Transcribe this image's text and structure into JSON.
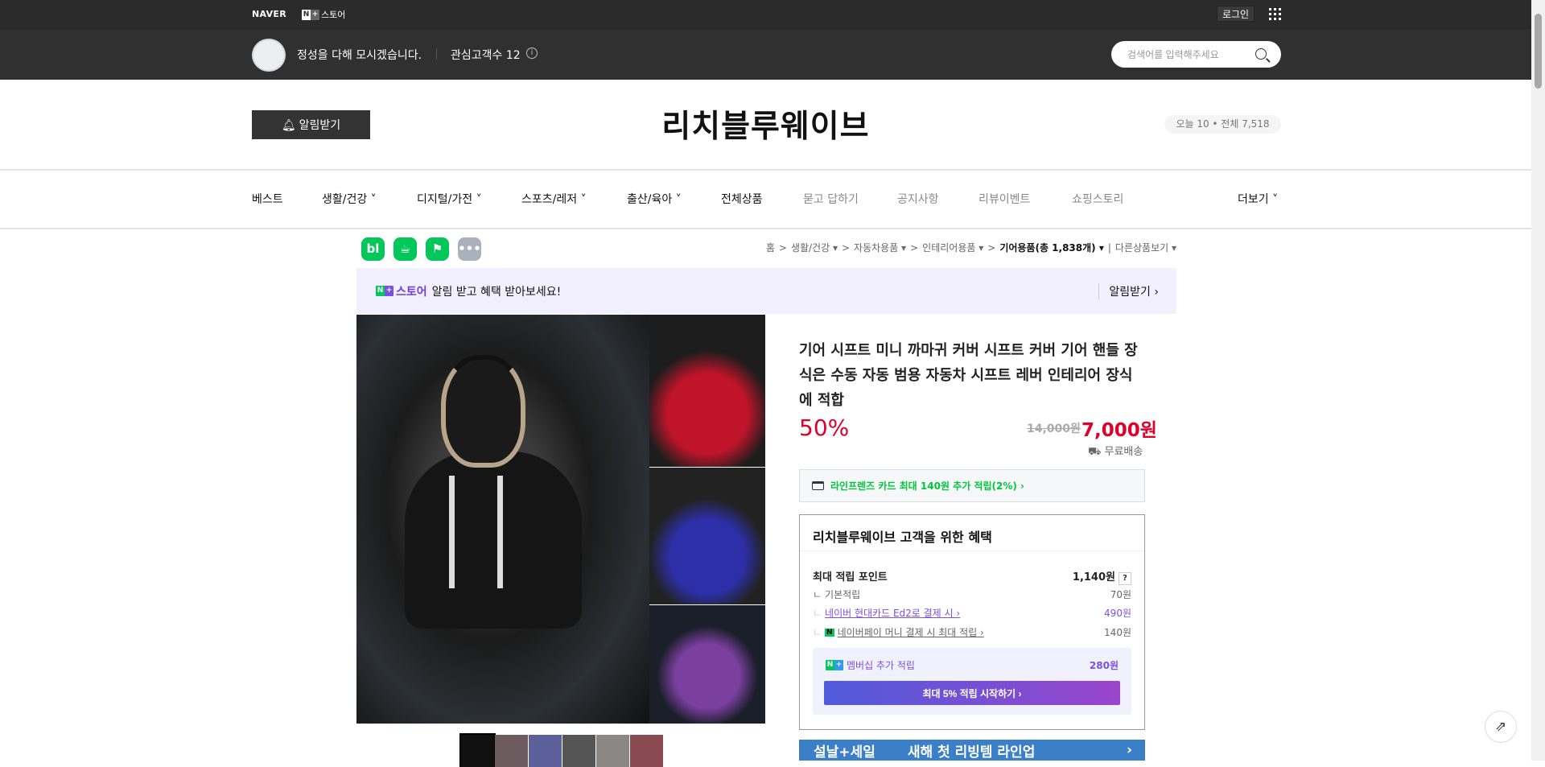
{
  "topbar": {
    "naver": "NAVER",
    "nplus_n": "N",
    "nplus_plus": "+",
    "store": "스토어",
    "login": "로그인"
  },
  "header": {
    "slogan": "정성을 다해 모시겠습니다.",
    "fans": "관심고객수 12",
    "search_placeholder": "검색어를 입력해주세요"
  },
  "store": {
    "name": "리치블루웨이브",
    "alarm": "알림받기",
    "visitors": "오늘 10 • 전체 7,518"
  },
  "nav": [
    "베스트",
    "생활/건강 ˅",
    "디지털/가전 ˅",
    "스포츠/레저 ˅",
    "출산/육아 ˅",
    "전체상품",
    "묻고 답하기",
    "공지사항",
    "리뷰이벤트",
    "쇼핑스토리",
    "더보기 ˅"
  ],
  "share_icons": [
    "bl",
    "☕",
    "⚑",
    "•••"
  ],
  "breadcrumb": [
    "홈",
    ">",
    "생활/건강 ▾",
    ">",
    "자동차용품 ▾",
    ">",
    "인테리어용품 ▾",
    ">",
    "기어용품(총 1,838개) ▾",
    "|",
    "다른상품보기 ▾"
  ],
  "banner": {
    "store": "스토어",
    "text": "알림 받고 혜택 받아보세요!",
    "action": "알림받기 ›"
  },
  "product": {
    "title": "기어 시프트 미니 까마귀 커버 시프트 커버 기어 핸들 장식은 수동 자동 범용 자동차 시프트 레버 인테리어 장식에 적합",
    "discount": "50%",
    "original_price": "14,000원",
    "price": "7,000원",
    "shipping": "무료배송",
    "card_offer": "라인프렌즈 카드 최대 140원 추가 적립(2%) ›"
  },
  "benefits": {
    "title": "리치블루웨이브 고객을 위한 혜택",
    "max_label": "최대 적립 포인트",
    "max_value": "1,140원",
    "help": "?",
    "rows": [
      {
        "label": "기본적립",
        "value": "70원"
      },
      {
        "label": "네이버 현대카드 Ed2로 결제 시 ›",
        "value": "490원"
      },
      {
        "label": "네이버페이 머니 결제 시 최대 적립 ›",
        "value": "140원"
      }
    ],
    "membership_label": "멤버십 추가 적립",
    "membership_value": "280원",
    "membership_button": "최대 5% 적립 시작하기 ›"
  },
  "promo": {
    "left": "설날+세일",
    "main": "새해 첫 리빙템 라인업",
    "arrow": "›"
  },
  "colors": {
    "accent": "#e0002a",
    "naver_green": "#03c75a",
    "purple": "#7a4fe8",
    "header": "#303030"
  }
}
